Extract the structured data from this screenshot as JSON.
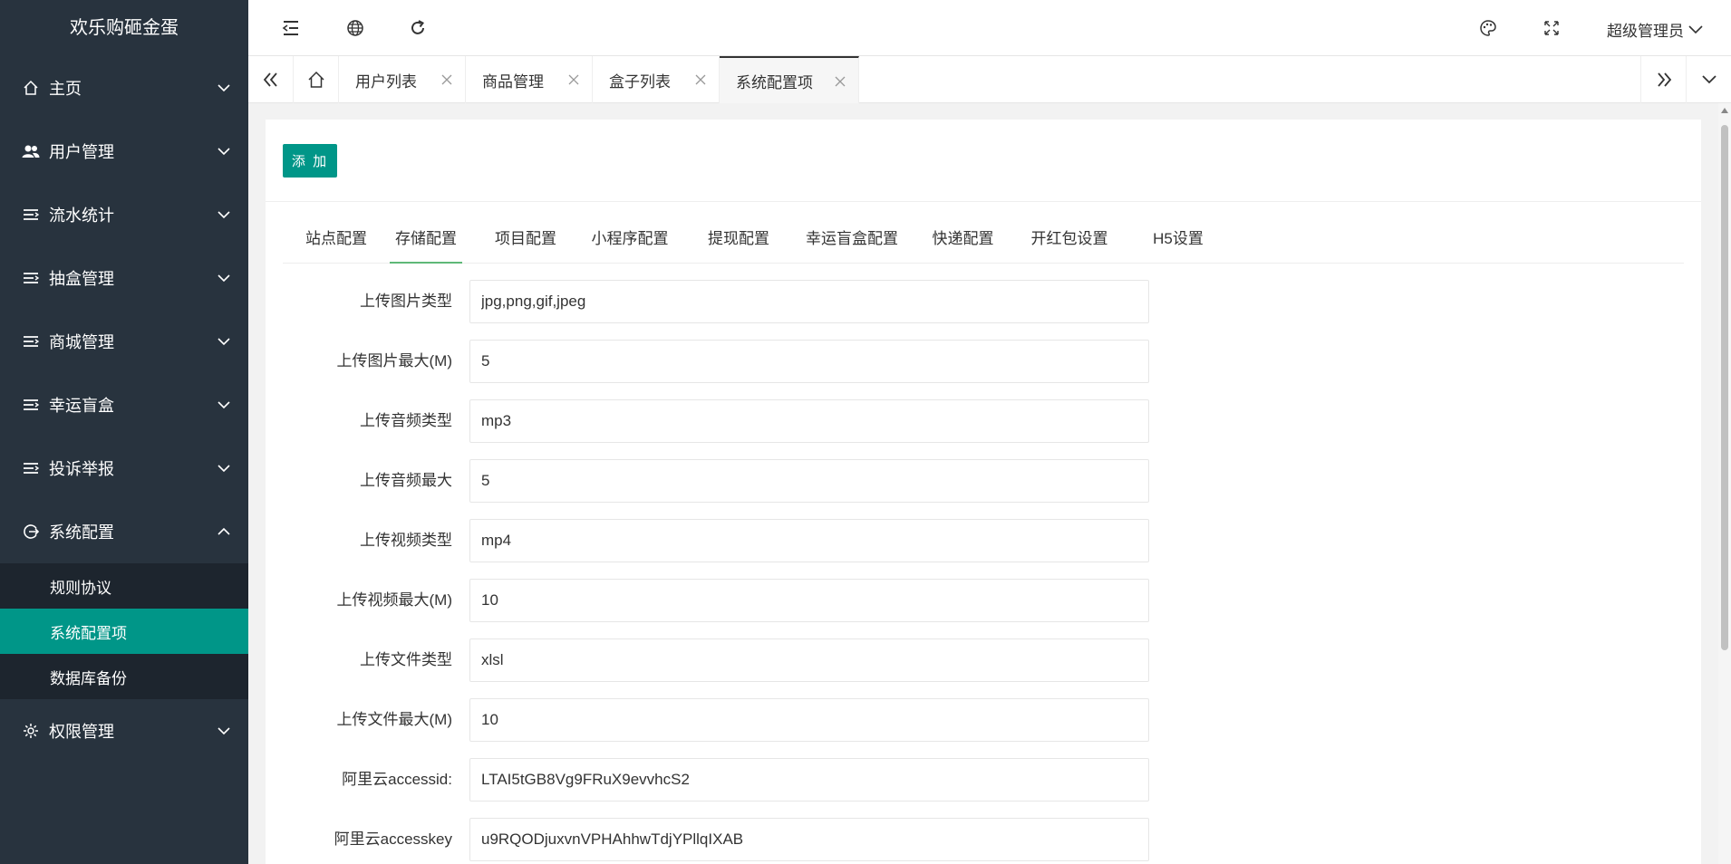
{
  "app": {
    "title": "欢乐购砸金蛋"
  },
  "sidebar": {
    "items": [
      {
        "label": "主页",
        "icon": "home-icon",
        "expanded": false
      },
      {
        "label": "用户管理",
        "icon": "users-icon",
        "expanded": false
      },
      {
        "label": "流水统计",
        "icon": "list-icon",
        "expanded": false
      },
      {
        "label": "抽盒管理",
        "icon": "list-icon",
        "expanded": false
      },
      {
        "label": "商城管理",
        "icon": "list-icon",
        "expanded": false
      },
      {
        "label": "幸运盲盒",
        "icon": "list-icon",
        "expanded": false
      },
      {
        "label": "投诉举报",
        "icon": "list-icon",
        "expanded": false
      },
      {
        "label": "系统配置",
        "icon": "system-icon",
        "expanded": true
      },
      {
        "label": "权限管理",
        "icon": "gear-icon",
        "expanded": false
      }
    ],
    "submenu": [
      {
        "label": "规则协议",
        "active": false
      },
      {
        "label": "系统配置项",
        "active": true
      },
      {
        "label": "数据库备份",
        "active": false
      }
    ]
  },
  "header": {
    "admin_label": "超级管理员"
  },
  "tabs": [
    {
      "label": "用户列表"
    },
    {
      "label": "商品管理"
    },
    {
      "label": "盒子列表"
    },
    {
      "label": "系统配置项",
      "active": true
    }
  ],
  "content": {
    "add_button": "添 加",
    "config_tabs": [
      {
        "label": "站点配置"
      },
      {
        "label": "存储配置",
        "active": true
      },
      {
        "label": "项目配置"
      },
      {
        "label": "小程序配置"
      },
      {
        "label": "提现配置"
      },
      {
        "label": "幸运盲盒配置"
      },
      {
        "label": "快递配置"
      },
      {
        "label": "开红包设置"
      },
      {
        "label": "H5设置"
      }
    ],
    "fields": [
      {
        "label": "上传图片类型",
        "value": "jpg,png,gif,jpeg"
      },
      {
        "label": "上传图片最大(M)",
        "value": "5"
      },
      {
        "label": "上传音频类型",
        "value": "mp3"
      },
      {
        "label": "上传音频最大",
        "value": "5"
      },
      {
        "label": "上传视频类型",
        "value": "mp4"
      },
      {
        "label": "上传视频最大(M)",
        "value": "10"
      },
      {
        "label": "上传文件类型",
        "value": "xlsl"
      },
      {
        "label": "上传文件最大(M)",
        "value": "10"
      },
      {
        "label": "阿里云accessid:",
        "value": "LTAI5tGB8Vg9FRuX9evvhcS2"
      },
      {
        "label": "阿里云accesskey",
        "value": "u9RQODjuxvnVPHAhhwTdjYPllqIXAB"
      }
    ]
  },
  "colors": {
    "sidebar_bg": "#28333e",
    "submenu_bg": "#1d252e",
    "accent": "#009688",
    "tab_underline": "#5fb878"
  }
}
